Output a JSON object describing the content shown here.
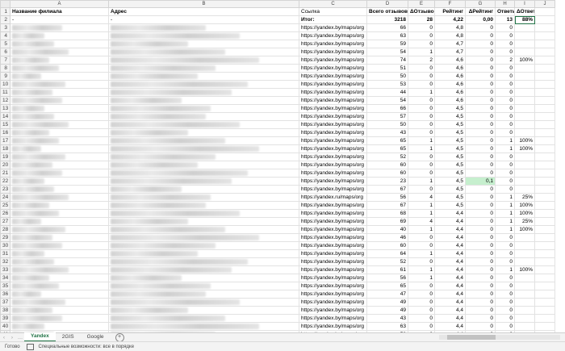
{
  "columns": [
    "A",
    "B",
    "C",
    "D",
    "E",
    "F",
    "G",
    "H",
    "I",
    "J"
  ],
  "header_row": {
    "rn": "1",
    "a": "Название филиала",
    "b": "Адрес",
    "c": "Ссылка",
    "d": "Всего отзывов",
    "e": "ΔОтзывов",
    "f": "Рейтинг",
    "g": "ΔРейтинг",
    "h": "Ответы",
    "i": "ΔОтветы"
  },
  "totals_row": {
    "rn": "2",
    "a": "-",
    "b": "-",
    "c": "Итог:",
    "d": "3218",
    "e": "28",
    "f": "4,22",
    "g": "0,00",
    "h": "13",
    "i": "88%"
  },
  "link_text": "https://yandex.by/maps/org",
  "rows": [
    {
      "rn": "3",
      "c": "https://yandex.by/maps/org",
      "d": "66",
      "e": "0",
      "f": "4,8",
      "g": "0",
      "h": "0",
      "i": ""
    },
    {
      "rn": "4",
      "c": "https://yandex.by/maps/org",
      "d": "63",
      "e": "0",
      "f": "4,8",
      "g": "0",
      "h": "0",
      "i": ""
    },
    {
      "rn": "5",
      "c": "https://yandex.by/maps/org",
      "d": "59",
      "e": "0",
      "f": "4,7",
      "g": "0",
      "h": "0",
      "i": ""
    },
    {
      "rn": "6",
      "c": "https://yandex.by/maps/org",
      "d": "54",
      "e": "1",
      "f": "4,7",
      "g": "0",
      "h": "0",
      "i": ""
    },
    {
      "rn": "7",
      "c": "https://yandex.by/maps/org",
      "d": "74",
      "e": "2",
      "f": "4,6",
      "g": "0",
      "h": "2",
      "i": "100%"
    },
    {
      "rn": "8",
      "c": "https://yandex.by/maps/org",
      "d": "51",
      "e": "0",
      "f": "4,6",
      "g": "0",
      "h": "0",
      "i": ""
    },
    {
      "rn": "9",
      "c": "https://yandex.by/maps/org",
      "d": "50",
      "e": "0",
      "f": "4,6",
      "g": "0",
      "h": "0",
      "i": ""
    },
    {
      "rn": "10",
      "c": "https://yandex.by/maps/org",
      "d": "53",
      "e": "0",
      "f": "4,6",
      "g": "0",
      "h": "0",
      "i": ""
    },
    {
      "rn": "11",
      "c": "https://yandex.by/maps/org",
      "d": "44",
      "e": "1",
      "f": "4,6",
      "g": "0",
      "h": "0",
      "i": ""
    },
    {
      "rn": "12",
      "c": "https://yandex.by/maps/org",
      "d": "54",
      "e": "0",
      "f": "4,6",
      "g": "0",
      "h": "0",
      "i": ""
    },
    {
      "rn": "13",
      "c": "https://yandex.by/maps/org",
      "d": "66",
      "e": "0",
      "f": "4,5",
      "g": "0",
      "h": "0",
      "i": ""
    },
    {
      "rn": "14",
      "c": "https://yandex.by/maps/org",
      "d": "57",
      "e": "0",
      "f": "4,5",
      "g": "0",
      "h": "0",
      "i": ""
    },
    {
      "rn": "15",
      "c": "https://yandex.by/maps/org",
      "d": "50",
      "e": "0",
      "f": "4,5",
      "g": "0",
      "h": "0",
      "i": ""
    },
    {
      "rn": "16",
      "c": "https://yandex.by/maps/org",
      "d": "43",
      "e": "0",
      "f": "4,5",
      "g": "0",
      "h": "0",
      "i": ""
    },
    {
      "rn": "17",
      "c": "https://yandex.by/maps/org",
      "d": "65",
      "e": "1",
      "f": "4,5",
      "g": "0",
      "h": "1",
      "i": "100%"
    },
    {
      "rn": "18",
      "c": "https://yandex.by/maps/org",
      "d": "65",
      "e": "1",
      "f": "4,5",
      "g": "0",
      "h": "1",
      "i": "100%"
    },
    {
      "rn": "19",
      "c": "https://yandex.by/maps/org",
      "d": "52",
      "e": "0",
      "f": "4,5",
      "g": "0",
      "h": "0",
      "i": ""
    },
    {
      "rn": "20",
      "c": "https://yandex.by/maps/org",
      "d": "60",
      "e": "0",
      "f": "4,5",
      "g": "0",
      "h": "0",
      "i": ""
    },
    {
      "rn": "21",
      "c": "https://yandex.by/maps/org",
      "d": "60",
      "e": "0",
      "f": "4,5",
      "g": "0",
      "h": "0",
      "i": ""
    },
    {
      "rn": "22",
      "c": "https://yandex.by/maps/org",
      "d": "23",
      "e": "1",
      "f": "4,5",
      "g": "0,1",
      "h": "0",
      "i": "",
      "g_green": true
    },
    {
      "rn": "23",
      "c": "https://yandex.by/maps/org",
      "d": "67",
      "e": "0",
      "f": "4,5",
      "g": "0",
      "h": "0",
      "i": ""
    },
    {
      "rn": "24",
      "c": "https://yandex.ru/maps/org",
      "d": "56",
      "e": "4",
      "f": "4,5",
      "g": "0",
      "h": "1",
      "i": "25%"
    },
    {
      "rn": "25",
      "c": "https://yandex.by/maps/org",
      "d": "67",
      "e": "1",
      "f": "4,5",
      "g": "0",
      "h": "1",
      "i": "100%"
    },
    {
      "rn": "26",
      "c": "https://yandex.by/maps/org",
      "d": "68",
      "e": "1",
      "f": "4,4",
      "g": "0",
      "h": "1",
      "i": "100%"
    },
    {
      "rn": "27",
      "c": "https://yandex.by/maps/org",
      "d": "69",
      "e": "4",
      "f": "4,4",
      "g": "0",
      "h": "1",
      "i": "25%"
    },
    {
      "rn": "28",
      "c": "https://yandex.by/maps/org",
      "d": "40",
      "e": "1",
      "f": "4,4",
      "g": "0",
      "h": "1",
      "i": "100%"
    },
    {
      "rn": "29",
      "c": "https://yandex.by/maps/org",
      "d": "46",
      "e": "0",
      "f": "4,4",
      "g": "0",
      "h": "0",
      "i": ""
    },
    {
      "rn": "30",
      "c": "https://yandex.by/maps/org",
      "d": "60",
      "e": "0",
      "f": "4,4",
      "g": "0",
      "h": "0",
      "i": ""
    },
    {
      "rn": "31",
      "c": "https://yandex.by/maps/org",
      "d": "64",
      "e": "1",
      "f": "4,4",
      "g": "0",
      "h": "0",
      "i": ""
    },
    {
      "rn": "32",
      "c": "https://yandex.by/maps/org",
      "d": "52",
      "e": "0",
      "f": "4,4",
      "g": "0",
      "h": "0",
      "i": ""
    },
    {
      "rn": "33",
      "c": "https://yandex.by/maps/org",
      "d": "61",
      "e": "1",
      "f": "4,4",
      "g": "0",
      "h": "1",
      "i": "100%"
    },
    {
      "rn": "34",
      "c": "https://yandex.by/maps/org",
      "d": "56",
      "e": "1",
      "f": "4,4",
      "g": "0",
      "h": "0",
      "i": ""
    },
    {
      "rn": "35",
      "c": "https://yandex.by/maps/org",
      "d": "65",
      "e": "0",
      "f": "4,4",
      "g": "0",
      "h": "0",
      "i": ""
    },
    {
      "rn": "36",
      "c": "https://yandex.by/maps/org",
      "d": "47",
      "e": "0",
      "f": "4,4",
      "g": "0",
      "h": "0",
      "i": ""
    },
    {
      "rn": "37",
      "c": "https://yandex.by/maps/org",
      "d": "49",
      "e": "0",
      "f": "4,4",
      "g": "0",
      "h": "0",
      "i": ""
    },
    {
      "rn": "38",
      "c": "https://yandex.by/maps/org",
      "d": "49",
      "e": "0",
      "f": "4,4",
      "g": "0",
      "h": "0",
      "i": ""
    },
    {
      "rn": "39",
      "c": "https://yandex.by/maps/org",
      "d": "43",
      "e": "0",
      "f": "4,4",
      "g": "0",
      "h": "0",
      "i": ""
    },
    {
      "rn": "40",
      "c": "https://yandex.by/maps/org",
      "d": "63",
      "e": "0",
      "f": "4,4",
      "g": "0",
      "h": "0",
      "i": ""
    },
    {
      "rn": "41",
      "c": "https://yandex.by/maps/org",
      "d": "58",
      "e": "0",
      "f": "4,4",
      "g": "0",
      "h": "0",
      "i": ""
    },
    {
      "rn": "42",
      "c": "https://yandex.by/maps/org",
      "d": "49",
      "e": "0",
      "f": "4,4",
      "g": "0",
      "h": "0",
      "i": ""
    }
  ],
  "sheet_tabs": [
    "Yandex",
    "2GIS",
    "Google"
  ],
  "active_tab": "Yandex",
  "add_sheet_label": "+",
  "status": {
    "ready": "Готово",
    "accessibility": "Специальные возможности: все в порядке"
  },
  "colors": {
    "accent": "#217346",
    "positive_fill": "#c6efce"
  }
}
